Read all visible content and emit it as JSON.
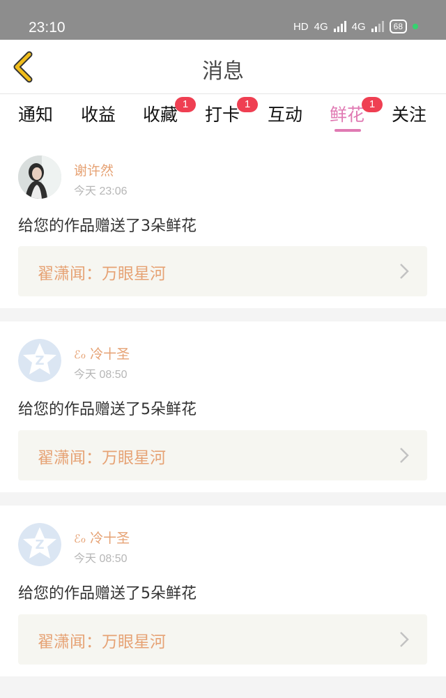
{
  "status": {
    "time": "23:10",
    "hd": "HD",
    "net1": "4G",
    "net2": "4G",
    "battery": "68"
  },
  "header": {
    "title": "消息"
  },
  "tabs": [
    {
      "label": "通知",
      "badge": ""
    },
    {
      "label": "收益",
      "badge": ""
    },
    {
      "label": "收藏",
      "badge": "1"
    },
    {
      "label": "打卡",
      "badge": "1"
    },
    {
      "label": "互动",
      "badge": ""
    },
    {
      "label": "鲜花",
      "badge": "1",
      "active": true
    },
    {
      "label": "关注",
      "badge": ""
    }
  ],
  "messages": [
    {
      "user": "谢许然",
      "time": "今天 23:06",
      "text": "给您的作品赠送了3朵鲜花",
      "work": "翟潇闻：万眼星河",
      "avatar_icon": "user-photo-icon"
    },
    {
      "user": "冷十圣",
      "user_prefix": "ℰℴ",
      "time": "今天 08:50",
      "text": "给您的作品赠送了5朵鲜花",
      "work": "翟潇闻：万眼星河",
      "avatar_icon": "default-star-avatar-icon"
    },
    {
      "user": "冷十圣",
      "user_prefix": "ℰℴ",
      "time": "今天 08:50",
      "text": "给您的作品赠送了5朵鲜花",
      "work": "翟潇闻：万眼星河",
      "avatar_icon": "default-star-avatar-icon"
    }
  ],
  "colors": {
    "accent": "#e07ab3",
    "username": "#e6a274",
    "badge": "#ef3f52",
    "back": "#f0bd1c"
  }
}
